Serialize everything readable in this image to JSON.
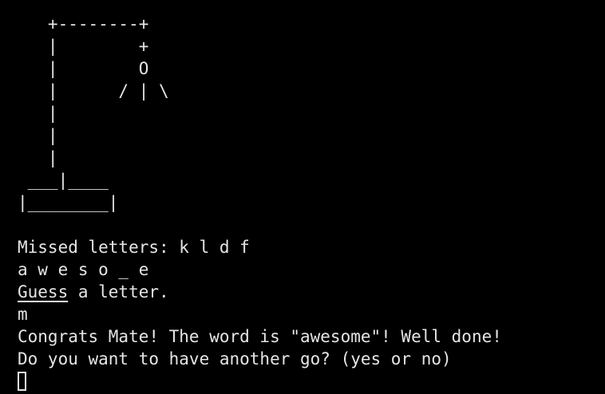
{
  "hangman_art": "   +--------+\n   |        +\n   |        O\n   |      / | \\\n   |\n   |\n   |\n ___|____\n|________|",
  "missed_line": "Missed letters: k l d f",
  "word_progress": "a w e s o _ e",
  "prompt": {
    "guess_word": "Guess",
    "rest": " a letter."
  },
  "user_input": "m",
  "congrats": "Congrats Mate! The word is \"awesome\"! Well done!",
  "play_again": "Do you want to have another go? (yes or no)"
}
